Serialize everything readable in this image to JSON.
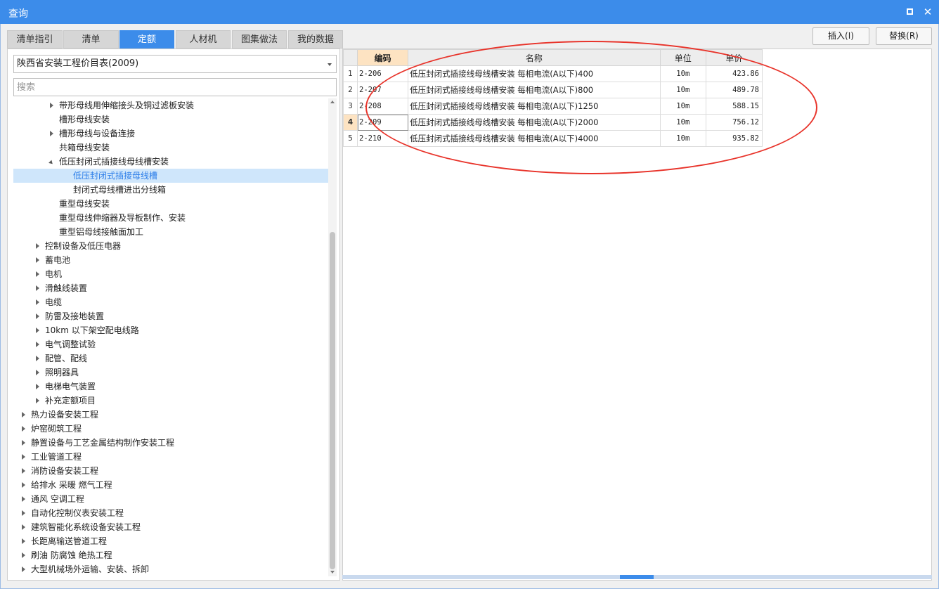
{
  "window": {
    "title": "查询",
    "maximize_icon": "maximize-icon",
    "close_icon": "close-icon",
    "close_glyph": "✕",
    "accent": "#3c8cea"
  },
  "tabs": [
    {
      "label": "清单指引",
      "active": false
    },
    {
      "label": "清单",
      "active": false
    },
    {
      "label": "定额",
      "active": true
    },
    {
      "label": "人材机",
      "active": false
    },
    {
      "label": "图集做法",
      "active": false
    },
    {
      "label": "我的数据",
      "active": false
    }
  ],
  "toolbar": {
    "insert_label": "插入(I)",
    "replace_label": "替换(R)"
  },
  "left": {
    "dropdown_value": "陕西省安装工程价目表(2009)",
    "search_placeholder": "搜索",
    "tree": [
      {
        "label": "带形母线用伸缩接头及铜过滤板安装",
        "level": 2,
        "toggle": "collapsed"
      },
      {
        "label": "槽形母线安装",
        "level": 2,
        "toggle": ""
      },
      {
        "label": "槽形母线与设备连接",
        "level": 2,
        "toggle": "collapsed"
      },
      {
        "label": "共箱母线安装",
        "level": 2,
        "toggle": ""
      },
      {
        "label": "低压封闭式插接线母线槽安装",
        "level": 2,
        "toggle": "expanded"
      },
      {
        "label": "低压封闭式插接母线槽",
        "level": 3,
        "toggle": "",
        "selected": true
      },
      {
        "label": "封闭式母线槽进出分线箱",
        "level": 3,
        "toggle": ""
      },
      {
        "label": "重型母线安装",
        "level": 2,
        "toggle": ""
      },
      {
        "label": "重型母线伸缩器及导板制作、安装",
        "level": 2,
        "toggle": ""
      },
      {
        "label": "重型铝母线接触面加工",
        "level": 2,
        "toggle": ""
      },
      {
        "label": "控制设备及低压电器",
        "level": 1,
        "toggle": "collapsed"
      },
      {
        "label": "蓄电池",
        "level": 1,
        "toggle": "collapsed"
      },
      {
        "label": "电机",
        "level": 1,
        "toggle": "collapsed"
      },
      {
        "label": "滑触线装置",
        "level": 1,
        "toggle": "collapsed"
      },
      {
        "label": "电缆",
        "level": 1,
        "toggle": "collapsed"
      },
      {
        "label": "防雷及接地装置",
        "level": 1,
        "toggle": "collapsed"
      },
      {
        "label": "10km 以下架空配电线路",
        "level": 1,
        "toggle": "collapsed"
      },
      {
        "label": "电气调整试验",
        "level": 1,
        "toggle": "collapsed"
      },
      {
        "label": "配管、配线",
        "level": 1,
        "toggle": "collapsed"
      },
      {
        "label": "照明器具",
        "level": 1,
        "toggle": "collapsed"
      },
      {
        "label": "电梯电气装置",
        "level": 1,
        "toggle": "collapsed"
      },
      {
        "label": "补充定额项目",
        "level": 1,
        "toggle": "collapsed"
      },
      {
        "label": "热力设备安装工程",
        "level": 0,
        "toggle": "collapsed"
      },
      {
        "label": "炉窑砌筑工程",
        "level": 0,
        "toggle": "collapsed"
      },
      {
        "label": "静置设备与工艺金属结构制作安装工程",
        "level": 0,
        "toggle": "collapsed"
      },
      {
        "label": "工业管道工程",
        "level": 0,
        "toggle": "collapsed"
      },
      {
        "label": "消防设备安装工程",
        "level": 0,
        "toggle": "collapsed"
      },
      {
        "label": "给排水 采暖 燃气工程",
        "level": 0,
        "toggle": "collapsed"
      },
      {
        "label": "通风 空调工程",
        "level": 0,
        "toggle": "collapsed"
      },
      {
        "label": "自动化控制仪表安装工程",
        "level": 0,
        "toggle": "collapsed"
      },
      {
        "label": "建筑智能化系统设备安装工程",
        "level": 0,
        "toggle": "collapsed"
      },
      {
        "label": "长距离输送管道工程",
        "level": 0,
        "toggle": "collapsed"
      },
      {
        "label": "刷油 防腐蚀 绝热工程",
        "level": 0,
        "toggle": "collapsed"
      },
      {
        "label": "大型机械场外运输、安装、拆卸",
        "level": 0,
        "toggle": "collapsed"
      }
    ]
  },
  "grid": {
    "columns": [
      "",
      "编码",
      "名称",
      "单位",
      "单价"
    ],
    "sorted_column": 1,
    "current_row": 4,
    "rows": [
      {
        "num": "1",
        "code": "2-206",
        "name": "低压封闭式插接线母线槽安装 每相电流(A以下)400",
        "unit": "10m",
        "price": "423.86"
      },
      {
        "num": "2",
        "code": "2-207",
        "name": "低压封闭式插接线母线槽安装 每相电流(A以下)800",
        "unit": "10m",
        "price": "489.78"
      },
      {
        "num": "3",
        "code": "2-208",
        "name": "低压封闭式插接线母线槽安装 每相电流(A以下)1250",
        "unit": "10m",
        "price": "588.15"
      },
      {
        "num": "4",
        "code": "2-209",
        "name": "低压封闭式插接线母线槽安装 每相电流(A以下)2000",
        "unit": "10m",
        "price": "756.12"
      },
      {
        "num": "5",
        "code": "2-210",
        "name": "低压封闭式插接线母线槽安装 每相电流(A以下)4000",
        "unit": "10m",
        "price": "935.82"
      }
    ]
  },
  "annotation": {
    "color": "#e8332a"
  }
}
